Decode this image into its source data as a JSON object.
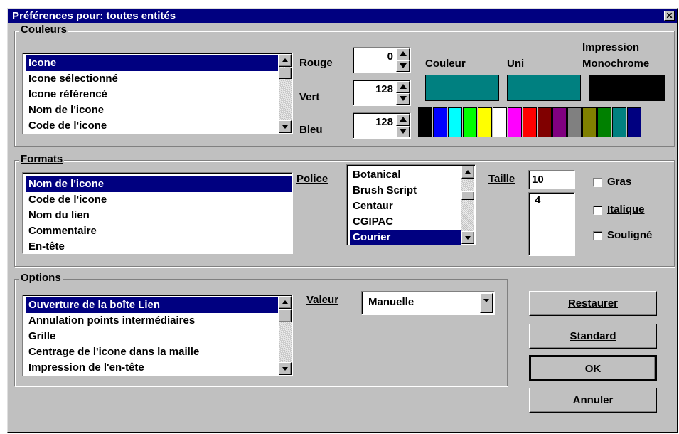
{
  "window": {
    "title": "Préférences pour: toutes entités",
    "close_glyph": "✕"
  },
  "couleurs": {
    "legend": "Couleurs",
    "items": [
      "Icone",
      "Icone sélectionné",
      "Icone référencé",
      "Nom de l'icone",
      "Code de l'icone"
    ],
    "selected_index": 0,
    "rouge_label": "Rouge",
    "rouge_value": "0",
    "vert_label": "Vert",
    "vert_value": "128",
    "bleu_label": "Bleu",
    "bleu_value": "128",
    "couleur_label": "Couleur",
    "couleur_color": "#008080",
    "uni_label": "Uni",
    "uni_color": "#008080",
    "impression_label_line1": "Impression",
    "impression_label_line2": "Monochrome",
    "impression_color": "#000000",
    "palette": [
      "#000000",
      "#0000ff",
      "#00ffff",
      "#00ff00",
      "#ffff00",
      "#ffffff",
      "#ff00ff",
      "#ff0000",
      "#800000",
      "#800080",
      "#808080",
      "#808000",
      "#008000",
      "#008080",
      "#000080"
    ]
  },
  "formats": {
    "legend": "Formats",
    "items": [
      "Nom de l'icone",
      "Code de l'icone",
      "Nom du lien",
      "Commentaire",
      "En-tête"
    ],
    "selected_index": 0,
    "police_label": "Police",
    "fonts": [
      "Botanical",
      "Brush Script",
      "Centaur",
      "CGIPAC",
      "Courier"
    ],
    "selected_font_index": 4,
    "taille_label": "Taille",
    "taille_value": "10",
    "taille_list": [
      "4"
    ],
    "gras_label": "Gras",
    "italique_label": "Italique",
    "souligne_label": "Souligné"
  },
  "options": {
    "legend": "Options",
    "items": [
      "Ouverture de la boîte Lien",
      "Annulation points intermédiaires",
      "Grille",
      "Centrage de l'icone dans la maille",
      "Impression de l'en-tête"
    ],
    "selected_index": 0,
    "valeur_label": "Valeur",
    "valeur_value": "Manuelle"
  },
  "buttons": {
    "restaurer": "Restaurer",
    "standard": "Standard",
    "ok": "OK",
    "annuler": "Annuler"
  }
}
